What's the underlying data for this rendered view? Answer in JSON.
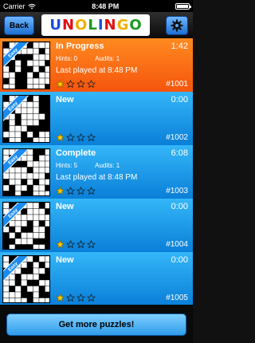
{
  "status_bar": {
    "carrier": "Carrier",
    "time": "8:48 PM"
  },
  "header": {
    "back_label": "Back",
    "logo_letters": [
      "U",
      "N",
      "O",
      "L",
      "I",
      "N",
      "G",
      "O"
    ],
    "logo_colors": [
      "#1a4fd8",
      "#e01010",
      "#f0b000",
      "#1a9a20",
      "#1a4fd8",
      "#e01010",
      "#f0b000",
      "#1a9a20"
    ]
  },
  "puzzles": [
    {
      "status": "In Progress",
      "time": "1:42",
      "hints_label": "Hints: 0",
      "audits_label": "Audits: 1",
      "last_played": "Last played at 8:48 PM",
      "number": "#1001",
      "stars": 1,
      "ribbon": "Easy",
      "kind": "progress"
    },
    {
      "status": "New",
      "time": "0:00",
      "number": "#1002",
      "stars": 1,
      "ribbon": "Easy",
      "kind": "new"
    },
    {
      "status": "Complete",
      "time": "6:08",
      "hints_label": "Hints: 5",
      "audits_label": "Audits: 1",
      "last_played": "Last played at 8:48 PM",
      "number": "#1003",
      "stars": 1,
      "ribbon": "Easy",
      "kind": "complete"
    },
    {
      "status": "New",
      "time": "0:00",
      "number": "#1004",
      "stars": 1,
      "ribbon": "Easy",
      "kind": "new"
    },
    {
      "status": "New",
      "time": "0:00",
      "number": "#1005",
      "stars": 1,
      "ribbon": "Easy",
      "kind": "new"
    }
  ],
  "footer": {
    "button_label": "Get more puzzles!"
  },
  "colors": {
    "star_filled": "#ffcc00",
    "star_empty": "#1a1a1a",
    "accent_blue": "#1d6fd1",
    "progress_orange": "#f5550d"
  }
}
